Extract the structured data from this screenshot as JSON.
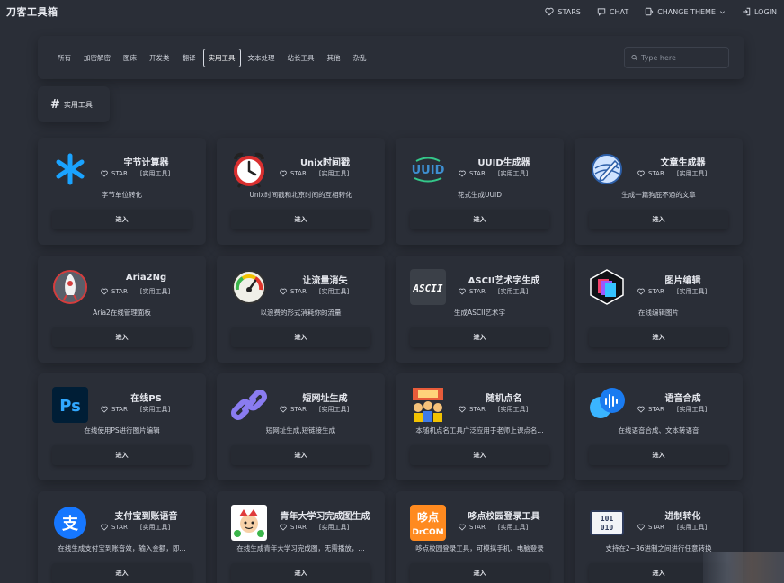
{
  "app": {
    "title": "刀客工具箱"
  },
  "topnav": {
    "stars": "STARS",
    "chat": "CHAT",
    "theme": "CHANGE THEME",
    "login": "LOGIN"
  },
  "filters": {
    "categories": [
      "所有",
      "加密解密",
      "图床",
      "开发类",
      "翻译",
      "实用工具",
      "文本处理",
      "站长工具",
      "其他",
      "杂乱"
    ],
    "active": "实用工具",
    "search_placeholder": "Type here"
  },
  "section": {
    "title": "实用工具"
  },
  "card_common": {
    "star_label": "STAR",
    "enter_label": "进入"
  },
  "cards": [
    {
      "name": "字节计算器",
      "tag": "[实用工具]",
      "desc": "字节单位转化",
      "icon": "asterisk-icon"
    },
    {
      "name": "Unix时间戳",
      "tag": "[实用工具]",
      "desc": "Unix时间戳和北京时间的互相转化",
      "icon": "alarm-clock-icon"
    },
    {
      "name": "UUID生成器",
      "tag": "[实用工具]",
      "desc": "花式生成UUID",
      "icon": "uuid-icon"
    },
    {
      "name": "文章生成器",
      "tag": "[实用工具]",
      "desc": "生成一篇狗屁不通的文章",
      "icon": "pen-globe-icon"
    },
    {
      "name": "Aria2Ng",
      "tag": "[实用工具]",
      "desc": "Aria2在线管理面板",
      "icon": "rocket-icon"
    },
    {
      "name": "让流量消失",
      "tag": "[实用工具]",
      "desc": "以浪费的形式消耗你的流量",
      "icon": "gauge-icon"
    },
    {
      "name": "ASCII艺术字生成",
      "tag": "[实用工具]",
      "desc": "生成ASCII艺术字",
      "icon": "ascii-icon"
    },
    {
      "name": "图片编辑",
      "tag": "[实用工具]",
      "desc": "在线编辑图片",
      "icon": "image-layers-icon"
    },
    {
      "name": "在线PS",
      "tag": "[实用工具]",
      "desc": "在线使用PS进行图片编辑",
      "icon": "photoshop-icon"
    },
    {
      "name": "短网址生成",
      "tag": "[实用工具]",
      "desc": "短网址生成,短链接生成",
      "icon": "link-icon"
    },
    {
      "name": "随机点名",
      "tag": "[实用工具]",
      "desc": "本随机点名工具广泛应用于老师上课点名...",
      "icon": "classroom-icon"
    },
    {
      "name": "语音合成",
      "tag": "[实用工具]",
      "desc": "在线语音合成、文本转语音",
      "icon": "voice-icon"
    },
    {
      "name": "支付宝到账语音",
      "tag": "[实用工具]",
      "desc": "在线生成支付宝到账音效，输入金额，即...",
      "icon": "alipay-icon"
    },
    {
      "name": "青年大学习完成图生成",
      "tag": "[实用工具]",
      "desc": "在线生成青年大学习完成图，无需播放，...",
      "icon": "cartoon-icon"
    },
    {
      "name": "哆点校园登录工具",
      "tag": "[实用工具]",
      "desc": "哆点校园登录工具，可模拟手机、电脑登录",
      "icon": "drcom-icon"
    },
    {
      "name": "进制转化",
      "tag": "[实用工具]",
      "desc": "支持在2~36进制之间进行任意转换",
      "icon": "binary-icon"
    }
  ],
  "icon_texts": {
    "uuid": "UUID",
    "ascii": "ASCII",
    "ps": "Ps",
    "alipay": "支",
    "drcom_top": "哆点",
    "drcom_bottom": "DrCOM",
    "binary_top": "101",
    "binary_bottom": "010"
  },
  "colors": {
    "background": "#2a2e37",
    "text": "#e6e8ee",
    "active_border": "#d7dbe3"
  }
}
